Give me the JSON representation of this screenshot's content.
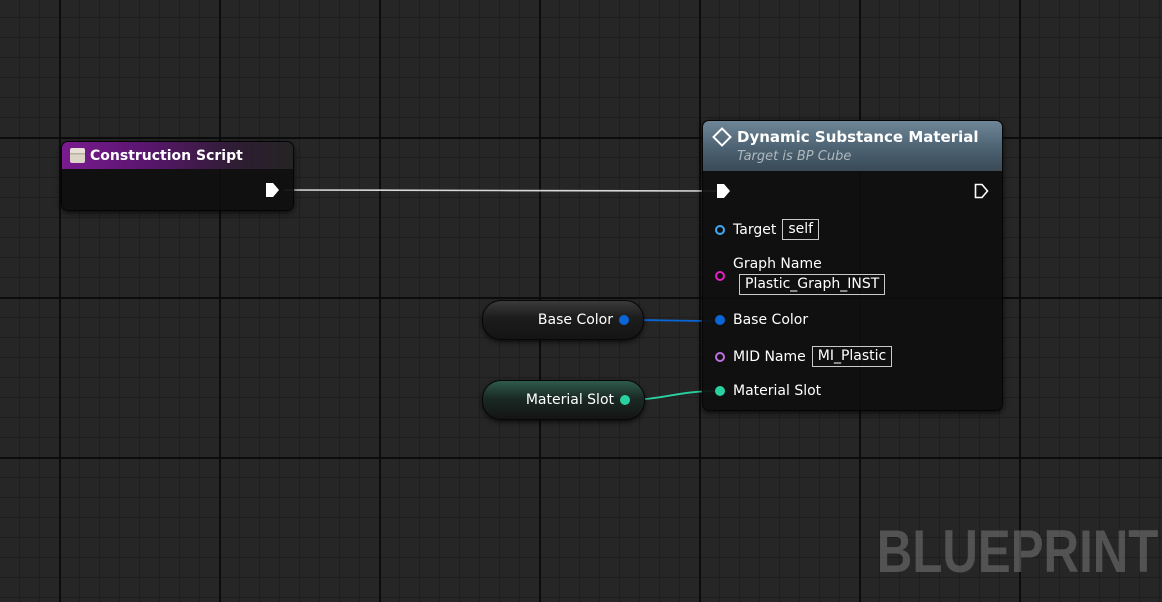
{
  "graph": {
    "watermark": "BLUEPRINT"
  },
  "event_node": {
    "title": "Construction Script",
    "icon": "event-icon",
    "header_color": "#7a1b8f"
  },
  "function_node": {
    "title": "Dynamic Substance Material",
    "subtitle": "Target is BP Cube",
    "icon": "function-icon",
    "header_color": "#6f8697",
    "pins": {
      "target": {
        "label": "Target",
        "value": "self",
        "color": "#3fa9f5"
      },
      "graph_name": {
        "label": "Graph Name",
        "value": "Plastic_Graph_INST",
        "color": "#e020c0"
      },
      "base_color": {
        "label": "Base Color",
        "color": "#0a66d6"
      },
      "mid_name": {
        "label": "MID Name",
        "value": "MI_Plastic",
        "color": "#c070e0"
      },
      "material_slot": {
        "label": "Material Slot",
        "color": "#2ad1a0"
      }
    }
  },
  "variables": {
    "base_color": {
      "label": "Base Color",
      "color": "#0a66d6"
    },
    "material_slot": {
      "label": "Material Slot",
      "color": "#2ad1a0"
    }
  }
}
